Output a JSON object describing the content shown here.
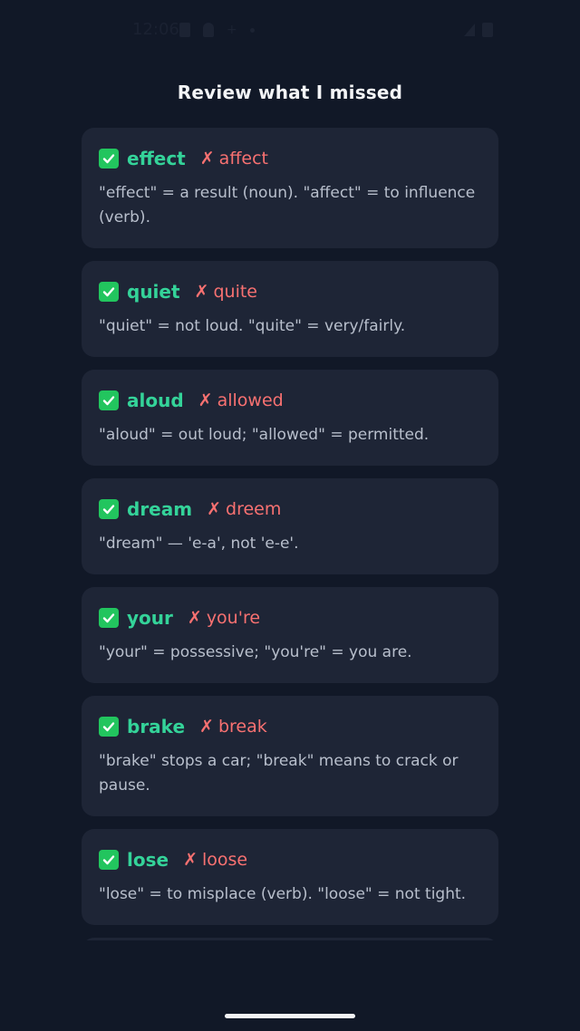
{
  "status_bar": {
    "time": "12:06"
  },
  "header": {
    "title": "Review what I missed"
  },
  "icons": {
    "correct": "check-mark-icon",
    "wrong": "cross-mark-icon",
    "cross_glyph": "✗"
  },
  "colors": {
    "background": "#111827",
    "card": "#1e2536",
    "correct": "#34d399",
    "wrong": "#f87171",
    "check_badge": "#22c55e"
  },
  "items": [
    {
      "correct": "effect",
      "wrong": "affect",
      "explanation": "\"effect\" = a result (noun). \"affect\" = to influence (verb)."
    },
    {
      "correct": "quiet",
      "wrong": "quite",
      "explanation": "\"quiet\" = not loud. \"quite\" = very/fairly."
    },
    {
      "correct": "aloud",
      "wrong": "allowed",
      "explanation": "\"aloud\" = out loud; \"allowed\" = permitted."
    },
    {
      "correct": "dream",
      "wrong": "dreem",
      "explanation": "\"dream\" — 'e-a', not 'e-e'."
    },
    {
      "correct": "your",
      "wrong": "you're",
      "explanation": "\"your\" = possessive; \"you're\" = you are."
    },
    {
      "correct": "brake",
      "wrong": "break",
      "explanation": "\"brake\" stops a car; \"break\" means to crack or pause."
    },
    {
      "correct": "lose",
      "wrong": "loose",
      "explanation": "\"lose\" = to misplace (verb). \"loose\" = not tight."
    }
  ]
}
